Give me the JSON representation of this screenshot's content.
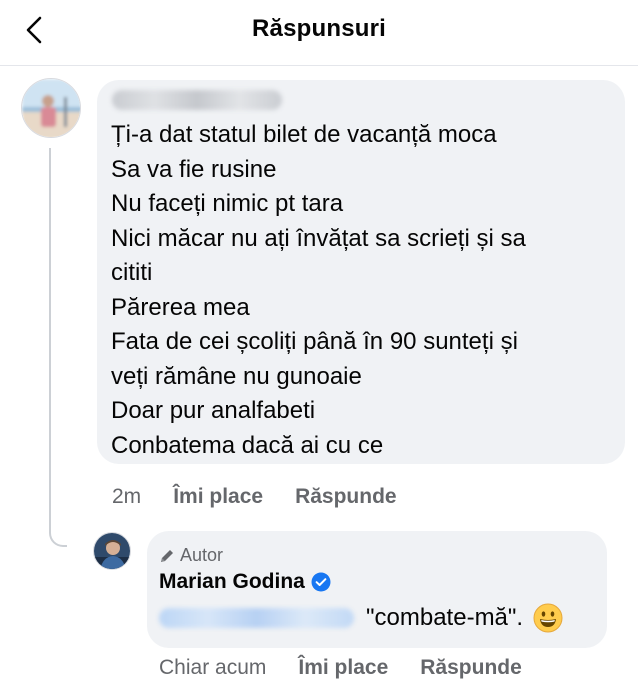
{
  "header": {
    "title": "Răspunsuri"
  },
  "comment": {
    "lines": [
      "Ți-a dat statul bilet de vacanță moca",
      "Sa va fie rusine",
      "Nu faceți nimic pt tara",
      "Nici măcar nu ați învățat sa scrieți și sa",
      "cititi",
      "Părerea mea",
      "Fata de cei școliți până în 90 sunteți și",
      "veți rămâne nu gunoaie",
      "Doar pur analfabeti",
      "Conbatema dacă ai cu ce"
    ],
    "time": "2m",
    "like_label": "Îmi place",
    "reply_label": "Răspunde"
  },
  "reply": {
    "author_tag": "Autor",
    "name": "Marian Godina",
    "text": "\"combate-mă\".",
    "time": "Chiar acum",
    "like_label": "Îmi place",
    "reply_label": "Răspunde"
  },
  "colors": {
    "bubble": "#f0f2f5",
    "secondary_text": "#65676b",
    "verified": "#1877f2",
    "thread_line": "#ccd0d5"
  },
  "icons": [
    "back-arrow-icon",
    "pencil-icon",
    "verified-badge-icon",
    "grinning-emoji-icon"
  ]
}
